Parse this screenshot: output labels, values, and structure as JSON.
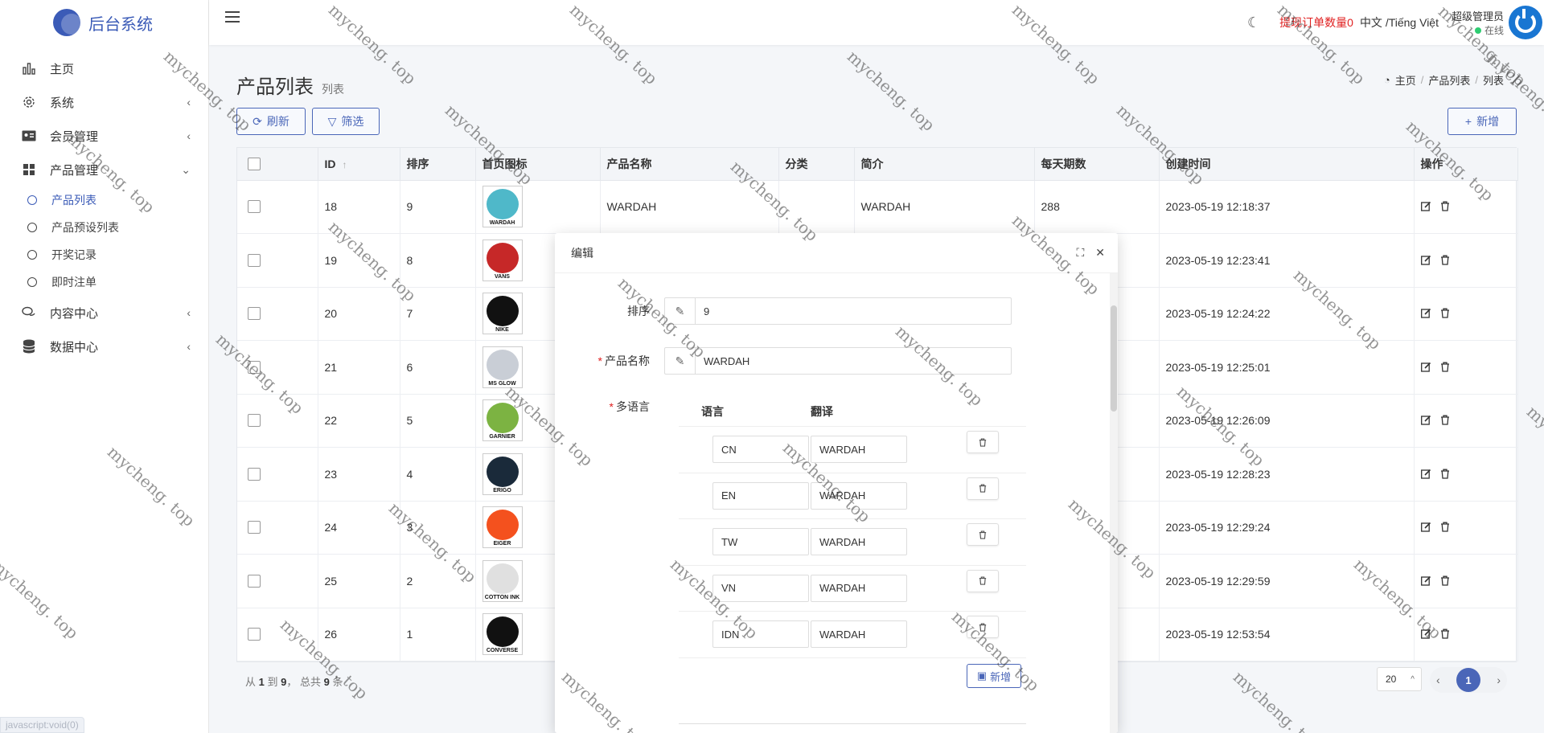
{
  "brand": {
    "name": "后台系统"
  },
  "sidebar": {
    "items": [
      {
        "label": "主页",
        "icon": "bar-chart-icon"
      },
      {
        "label": "系统",
        "icon": "gear-icon"
      },
      {
        "label": "会员管理",
        "icon": "id-card-icon"
      },
      {
        "label": "产品管理",
        "icon": "grid-icon"
      },
      {
        "label": "内容中心",
        "icon": "chat-icon"
      },
      {
        "label": "数据中心",
        "icon": "database-icon"
      }
    ],
    "subitems": [
      "产品列表",
      "产品预设列表",
      "开奖记录",
      "即时注单"
    ]
  },
  "status_url": "javascript:void(0)",
  "header": {
    "withdraw_label": "提现订单数量",
    "withdraw_count": "0",
    "lang": "中文 /Tiếng Việt",
    "user_name": "超级管理员",
    "user_status": "在线"
  },
  "page": {
    "title": "产品列表",
    "subtitle": "列表",
    "breadcrumb": [
      "主页",
      "产品列表",
      "列表"
    ]
  },
  "toolbar": {
    "refresh": "刷新",
    "filter": "筛选",
    "add": "新增"
  },
  "table": {
    "headers": [
      "ID",
      "排序",
      "首页图标",
      "产品名称",
      "分类",
      "简介",
      "每天期数",
      "创建时间",
      "操作"
    ],
    "rows": [
      {
        "id": "18",
        "sort": "9",
        "logo": "WARDAH",
        "name": "WARDAH",
        "category": "",
        "intro": "WARDAH",
        "daily": "288",
        "created": "2023-05-19 12:18:37",
        "color": "#4fb8c9"
      },
      {
        "id": "19",
        "sort": "8",
        "logo": "VANS",
        "name": "",
        "category": "",
        "intro": "",
        "daily": "",
        "created": "2023-05-19 12:23:41",
        "color": "#c62828"
      },
      {
        "id": "20",
        "sort": "7",
        "logo": "NIKE",
        "name": "",
        "category": "",
        "intro": "",
        "daily": "",
        "created": "2023-05-19 12:24:22",
        "color": "#111111"
      },
      {
        "id": "21",
        "sort": "6",
        "logo": "MS GLOW",
        "name": "",
        "category": "",
        "intro": "",
        "daily": "",
        "created": "2023-05-19 12:25:01",
        "color": "#c9ced6"
      },
      {
        "id": "22",
        "sort": "5",
        "logo": "GARNIER",
        "name": "",
        "category": "",
        "intro": "",
        "daily": "",
        "created": "2023-05-19 12:26:09",
        "color": "#7cb342"
      },
      {
        "id": "23",
        "sort": "4",
        "logo": "ERIGO",
        "name": "",
        "category": "",
        "intro": "",
        "daily": "",
        "created": "2023-05-19 12:28:23",
        "color": "#1a2a3a"
      },
      {
        "id": "24",
        "sort": "3",
        "logo": "EIGER",
        "name": "",
        "category": "",
        "intro": "",
        "daily": "",
        "created": "2023-05-19 12:29:24",
        "color": "#f4511e"
      },
      {
        "id": "25",
        "sort": "2",
        "logo": "COTTON INK",
        "name": "",
        "category": "",
        "intro": "",
        "daily": "",
        "created": "2023-05-19 12:29:59",
        "color": "#e0e0e0"
      },
      {
        "id": "26",
        "sort": "1",
        "logo": "CONVERSE",
        "name": "",
        "category": "",
        "intro": "",
        "daily": "",
        "created": "2023-05-19 12:53:54",
        "color": "#111111"
      }
    ]
  },
  "footer": {
    "prefix": "从",
    "from": "1",
    "to_word": "到",
    "to": "9",
    "total_word": "， 总共",
    "total": "9",
    "suffix": "条"
  },
  "pagination": {
    "page_size": "20",
    "current": "1"
  },
  "modal": {
    "title": "编辑",
    "sort_label": "排序",
    "sort_value": "9",
    "name_label": "产品名称",
    "name_value": "WARDAH",
    "ml_label": "多语言",
    "ml_col_lang": "语言",
    "ml_col_trans": "翻译",
    "translations": [
      {
        "lang": "CN",
        "text": "WARDAH"
      },
      {
        "lang": "EN",
        "text": "WARDAH"
      },
      {
        "lang": "TW",
        "text": "WARDAH"
      },
      {
        "lang": "VN",
        "text": "WARDAH"
      },
      {
        "lang": "IDN",
        "text": "WARDAH"
      }
    ],
    "add_label": "新增"
  },
  "watermark": "mycheng. top"
}
